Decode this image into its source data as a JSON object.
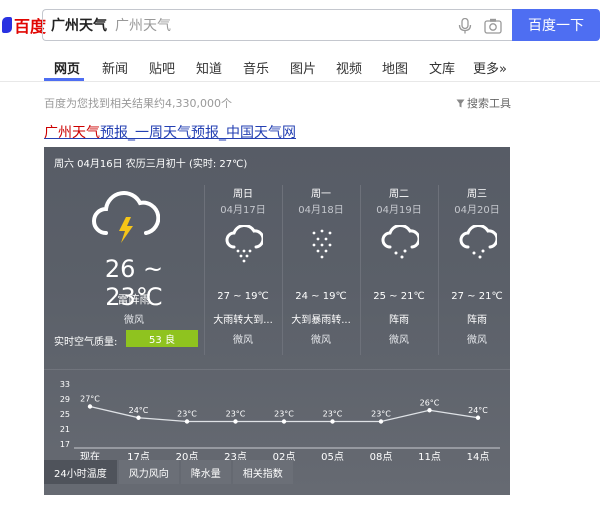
{
  "logo": {
    "text": "百度"
  },
  "search": {
    "value": "广州天气",
    "suggest": "广州天气",
    "button": "百度一下"
  },
  "nav": [
    {
      "label": "网页",
      "active": true
    },
    {
      "label": "新闻"
    },
    {
      "label": "贴吧"
    },
    {
      "label": "知道"
    },
    {
      "label": "音乐"
    },
    {
      "label": "图片"
    },
    {
      "label": "视频"
    },
    {
      "label": "地图"
    },
    {
      "label": "文库"
    },
    {
      "label": "更多»"
    }
  ],
  "stats": "百度为您找到相关结果约4,330,000个",
  "tools": "搜索工具",
  "result": {
    "title_highlight": "广州天气",
    "title_rest": "预报_一周天气预报_中国天气网"
  },
  "weather": {
    "header": "周六 04月16日 农历三月初十 (实时: 27℃)",
    "today": {
      "temp": "26 ~ 23℃",
      "condition": "雷阵雨",
      "wind": "微风",
      "aqi_label": "实时空气质量:",
      "aqi": "53 良"
    },
    "forecast": [
      {
        "day": "周日",
        "date": "04月17日",
        "temp": "27 ~ 19℃",
        "condition": "大雨转大到...",
        "wind": "微风",
        "icon": "heavy-rain-icon"
      },
      {
        "day": "周一",
        "date": "04月18日",
        "temp": "24 ~ 19℃",
        "condition": "大到暴雨转...",
        "wind": "微风",
        "icon": "rainstorm-icon"
      },
      {
        "day": "周二",
        "date": "04月19日",
        "temp": "25 ~ 21℃",
        "condition": "阵雨",
        "wind": "微风",
        "icon": "shower-icon"
      },
      {
        "day": "周三",
        "date": "04月20日",
        "temp": "27 ~ 21℃",
        "condition": "阵雨",
        "wind": "微风",
        "icon": "shower-icon"
      }
    ],
    "tabs": [
      {
        "label": "24小时温度",
        "active": true
      },
      {
        "label": "风力风向"
      },
      {
        "label": "降水量"
      },
      {
        "label": "相关指数"
      }
    ]
  },
  "chart_data": {
    "type": "line",
    "categories": [
      "现在",
      "17点",
      "20点",
      "23点",
      "02点",
      "05点",
      "08点",
      "11点",
      "14点"
    ],
    "values": [
      27,
      24,
      23,
      23,
      23,
      23,
      23,
      26,
      24
    ],
    "value_labels": [
      "27°C",
      "24°C",
      "23°C",
      "23°C",
      "23°C",
      "23°C",
      "23°C",
      "26°C",
      "24°C"
    ],
    "yticks": [
      33,
      29,
      25,
      21,
      17
    ],
    "ylim": [
      17,
      33
    ],
    "grid": false
  },
  "colors": {
    "accent": "#4e6ef2",
    "aqi_good": "#8fc31f",
    "logo_red": "#e10602"
  }
}
